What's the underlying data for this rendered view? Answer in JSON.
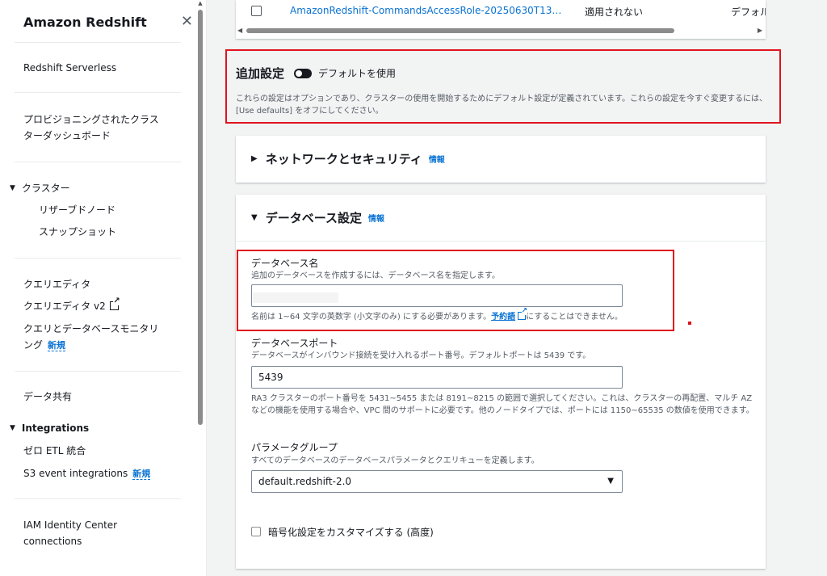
{
  "sidebar": {
    "title": "Amazon Redshift",
    "items": {
      "serverless": "Redshift Serverless",
      "provisioned_line1": "プロビジョニングされたクラス",
      "provisioned_line2": "ターダッシュボード",
      "clusters": "クラスター",
      "reserved_nodes": "リザーブドノード",
      "snapshots": "スナップショット",
      "query_editor": "クエリエディタ",
      "query_editor_v2": "クエリエディタ v2",
      "query_monitor_line1": "クエリとデータベースモニタリ",
      "query_monitor_line2": "ング",
      "datashare": "データ共有",
      "integrations": "Integrations",
      "zero_etl": "ゼロ ETL 統合",
      "s3_event": "S3 event integrations",
      "iam_line1": "IAM Identity Center",
      "iam_line2": "connections"
    },
    "new_badge": "新規"
  },
  "top_table": {
    "role": "AmazonRedshift-CommandsAccessRole-20250630T13…",
    "status": "適用されない",
    "default": "デフォルト"
  },
  "additional_settings": {
    "title": "追加設定",
    "toggle_label": "デフォルトを使用",
    "description": "これらの設定はオプションであり、クラスターの使用を開始するためにデフォルト設定が定義されています。これらの設定を今すぐ変更するには、[Use defaults] をオフにしてください。"
  },
  "network": {
    "title": "ネットワークとセキュリティ",
    "info": "情報"
  },
  "database": {
    "title": "データベース設定",
    "info": "情報",
    "db_name_label": "データベース名",
    "db_name_desc": "追加のデータベースを作成するには、データベース名を指定します。",
    "db_name_value": "",
    "db_name_hint_pre": "名前は 1~64 文字の英数字 (小文字のみ) にする必要があります。",
    "db_name_hint_link": "予約語",
    "db_name_hint_post": "にすることはできません。",
    "port_label": "データベースポート",
    "port_desc": "データベースがインバウンド接続を受け入れるポート番号。デフォルトポートは 5439 です。",
    "port_value": "5439",
    "port_hint": "RA3 クラスターのポート番号を 5431~5455 または 8191~8215 の範囲で選択してください。これは、クラスターの再配置、マルチ AZ などの機能を使用する場合や、VPC 間のサポートに必要です。他のノードタイプでは、ポートには 1150~65535 の数値を使用できます。",
    "param_label": "パラメータグループ",
    "param_desc": "すべてのデータベースのデータベースパラメータとクエリキューを定義します。",
    "param_value": "default.redshift-2.0",
    "encrypt_label": "暗号化設定をカスタマイズする (高度)"
  }
}
